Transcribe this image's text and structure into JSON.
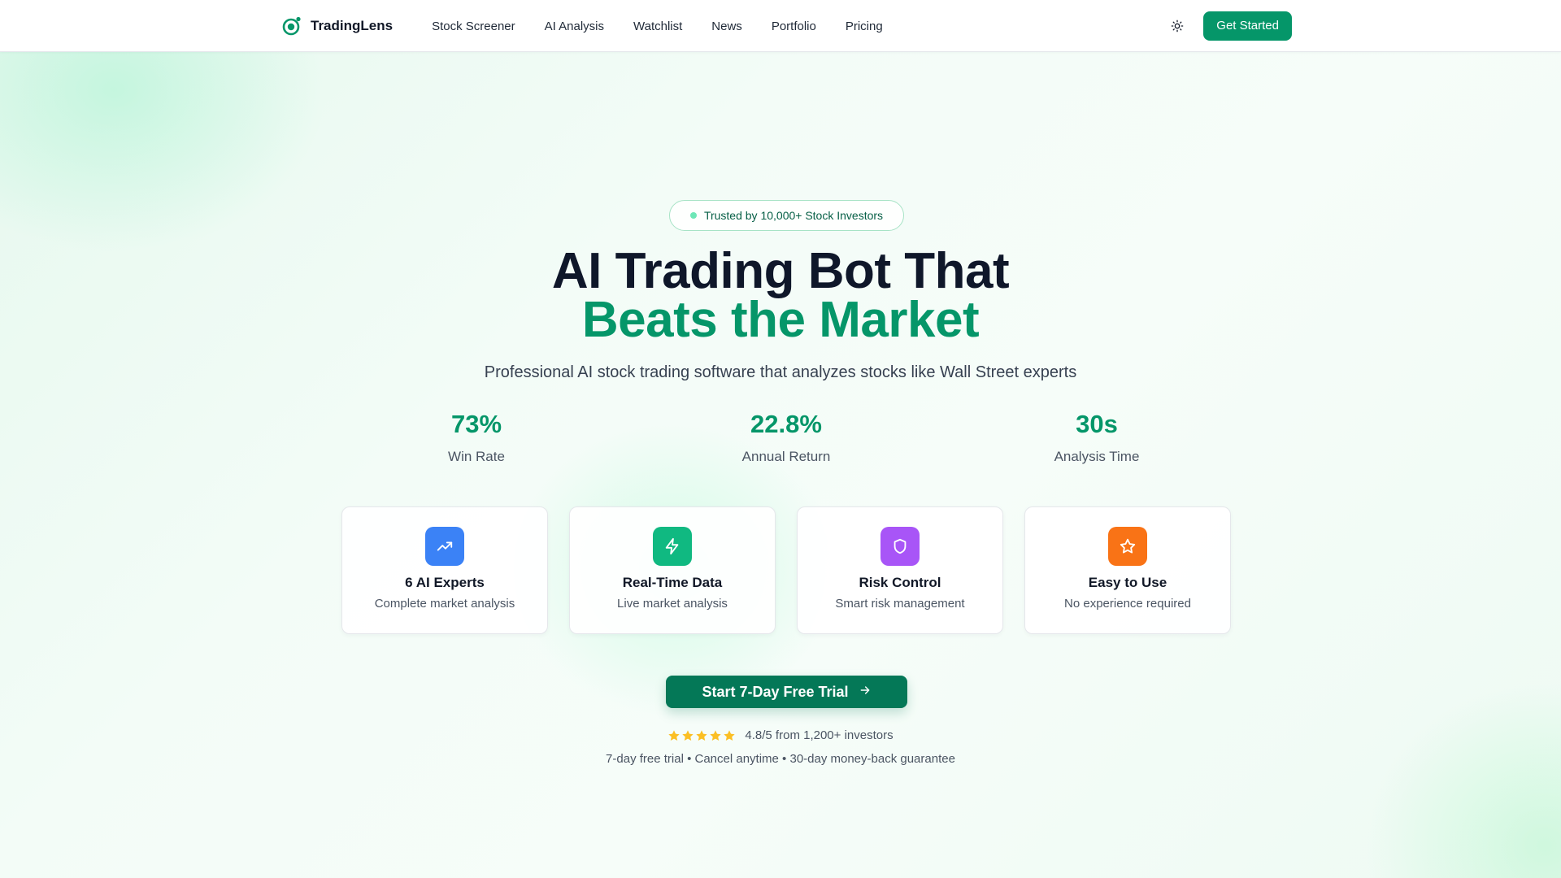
{
  "brand": {
    "name": "TradingLens",
    "accent": "#059669"
  },
  "nav": {
    "links": [
      "Stock Screener",
      "AI Analysis",
      "Watchlist",
      "News",
      "Portfolio",
      "Pricing"
    ],
    "theme_icon": "sun-icon",
    "cta_label": "Get Started"
  },
  "hero": {
    "badge": "Trusted by 10,000+ Stock Investors",
    "headline_line1": "AI Trading Bot That",
    "headline_line2": "Beats the Market",
    "subheadline": "Professional AI stock trading software that analyzes stocks like Wall Street experts"
  },
  "stats": [
    {
      "value": "73%",
      "label": "Win Rate"
    },
    {
      "value": "22.8%",
      "label": "Annual Return"
    },
    {
      "value": "30s",
      "label": "Analysis Time"
    }
  ],
  "features": [
    {
      "title": "6 AI Experts",
      "desc": "Complete market analysis",
      "icon": "trending-up-icon",
      "color": "#3b82f6"
    },
    {
      "title": "Real-Time Data",
      "desc": "Live market analysis",
      "icon": "lightning-icon",
      "color": "#10b981"
    },
    {
      "title": "Risk Control",
      "desc": "Smart risk management",
      "icon": "shield-icon",
      "color": "#a855f7"
    },
    {
      "title": "Easy to Use",
      "desc": "No experience required",
      "icon": "star-icon",
      "color": "#f97316"
    }
  ],
  "cta": {
    "label": "Start 7-Day Free Trial",
    "icon": "arrow-right-icon"
  },
  "rating": {
    "stars": 5,
    "text": "4.8/5 from 1,200+ investors",
    "star_color": "#fbbf24"
  },
  "guarantee": "7-day free trial • Cancel anytime • 30-day money-back guarantee"
}
